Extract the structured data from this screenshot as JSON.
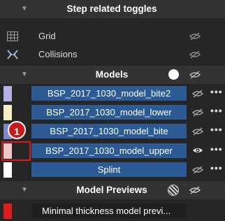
{
  "sections": {
    "step": {
      "title": "Step related toggles"
    },
    "models": {
      "title": "Models"
    },
    "previews": {
      "title": "Model Previews"
    }
  },
  "toggles": [
    {
      "label": "Grid",
      "icon": "grid-icon"
    },
    {
      "label": "Collisions",
      "icon": "collisions-icon"
    }
  ],
  "models": [
    {
      "label": "BSP_2017_1030_model_bite2",
      "swatch": "#b5b0e6",
      "visible": false
    },
    {
      "label": "BSP_2017_1030_model_lower",
      "swatch": "#f3efc0",
      "visible": false
    },
    {
      "label": "BSP_2017_1030_model_bite",
      "swatch": "#7d87c8",
      "visible": false
    },
    {
      "label": "BSP_2017_1030_model_upper",
      "swatch": "#f2c7c7",
      "visible": true
    },
    {
      "label": "Splint",
      "swatch": "#ffffff",
      "visible": false
    }
  ],
  "preview": {
    "label": "Minimal thickness model previ...",
    "swatch": "#e21c1c"
  },
  "annotation": {
    "number": "1"
  },
  "colors": {
    "accent_button": "#2c5a95",
    "header_bg": "#333333",
    "annotation": "#c81818"
  }
}
